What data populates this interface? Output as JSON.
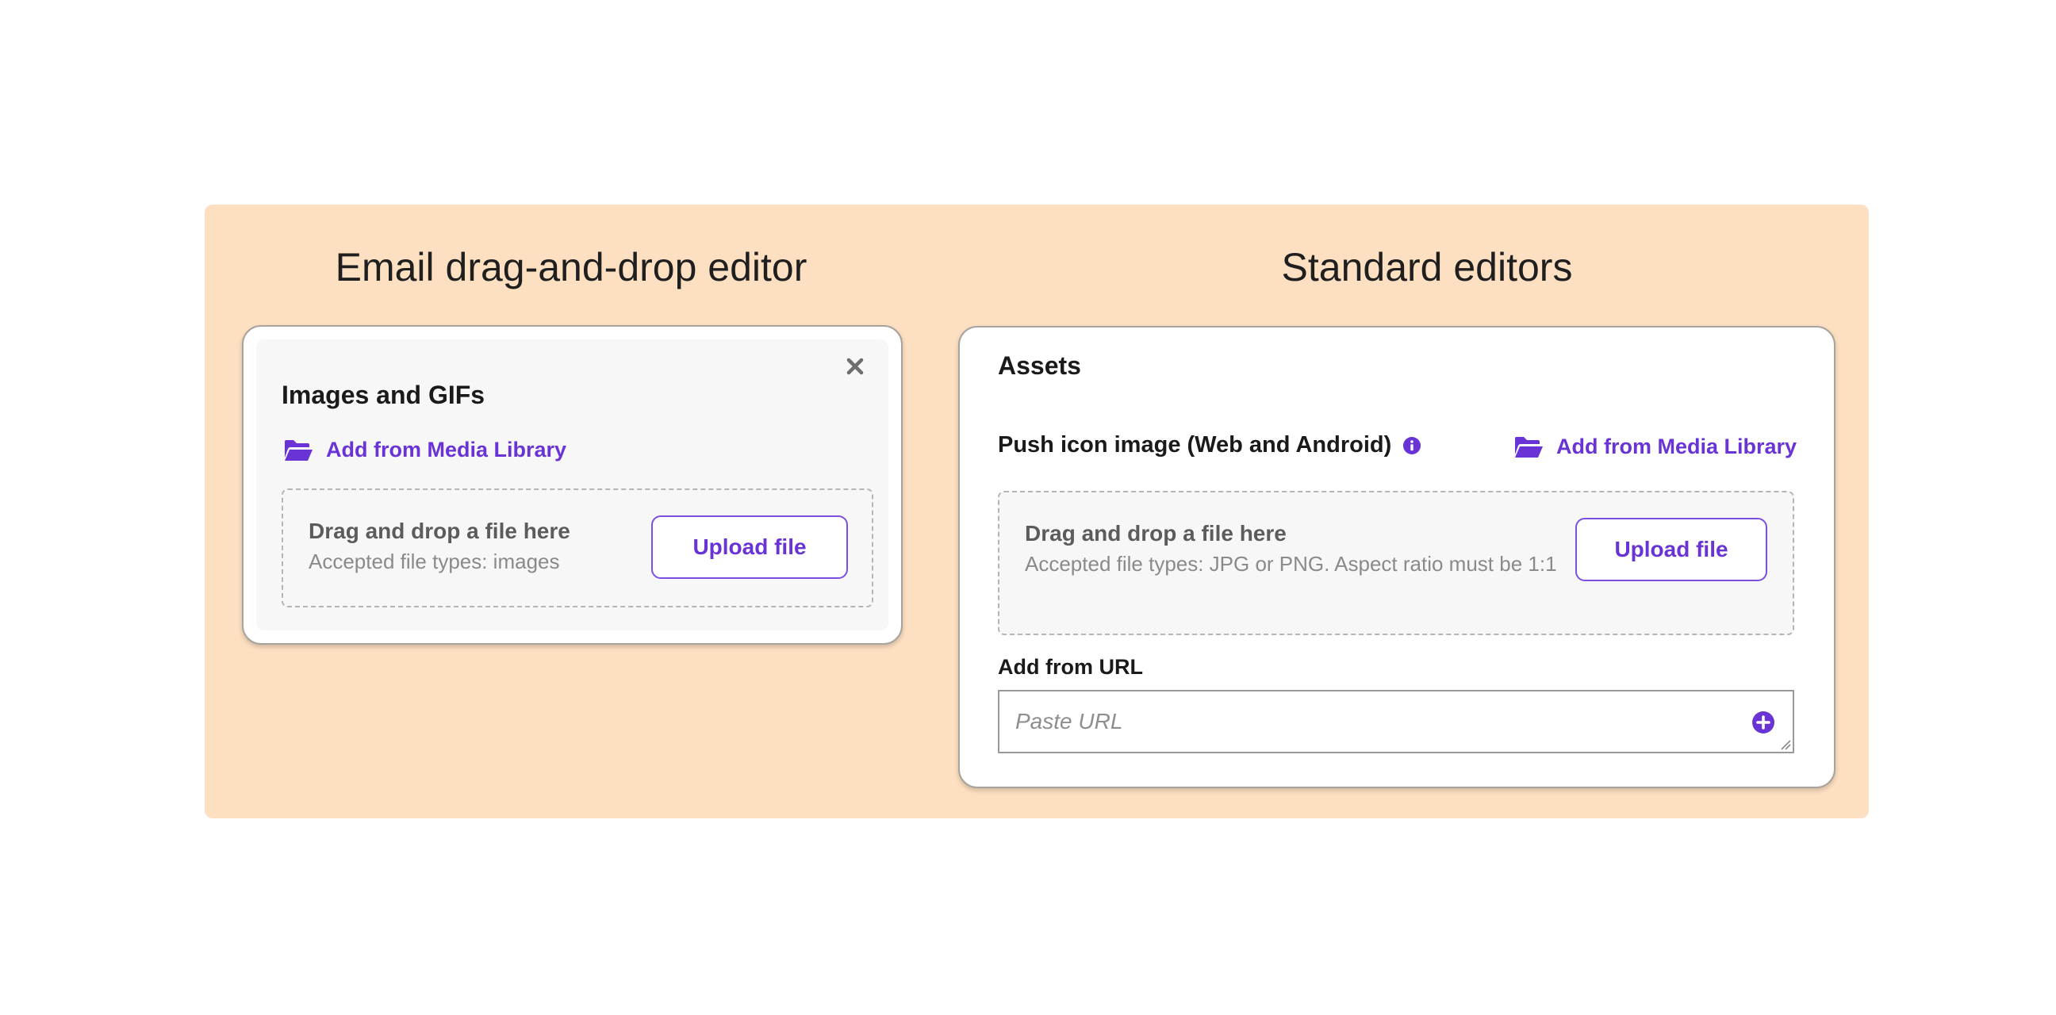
{
  "left_section": {
    "title": "Email drag-and-drop editor",
    "card": {
      "heading": "Images and GIFs",
      "media_link": "Add from Media Library",
      "dropzone": {
        "title": "Drag and drop a file here",
        "subtitle": "Accepted file types: images",
        "upload_label": "Upload file"
      },
      "close_icon": "close-icon"
    }
  },
  "right_section": {
    "title": "Standard editors",
    "card": {
      "heading": "Assets",
      "field_label": "Push icon image (Web and Android)",
      "info_icon": "info-icon",
      "media_link": "Add from Media Library",
      "dropzone": {
        "title": "Drag and drop a file here",
        "subtitle": "Accepted file types: JPG or PNG. Aspect ratio must be 1:1",
        "upload_label": "Upload file"
      },
      "url_label": "Add from URL",
      "url_input": {
        "value": "",
        "placeholder": "Paste URL"
      },
      "add_icon": "plus-circle-icon"
    }
  },
  "colors": {
    "panel_background": "#fddfc1",
    "accent": "#6933d6",
    "card_border": "#a9a39d",
    "dropzone_background": "#f7f7f7"
  }
}
